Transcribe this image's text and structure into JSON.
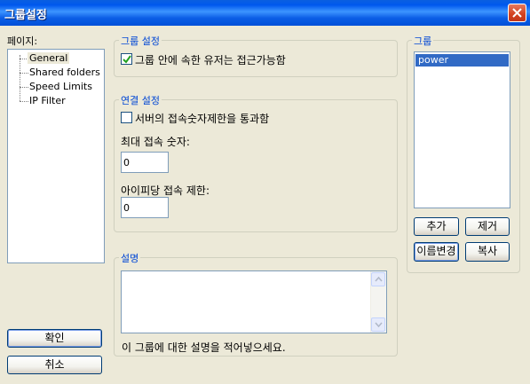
{
  "window": {
    "title": "그룹설정"
  },
  "pages": {
    "label": "페이지:",
    "items": [
      "General",
      "Shared folders",
      "Speed Limits",
      "IP Filter"
    ]
  },
  "group_settings": {
    "title": "그룹 설정",
    "access_checkbox_label": "그룹 안에 속한 유저는 접근가능함",
    "access_checked": true
  },
  "connection_settings": {
    "title": "연결 설정",
    "bypass_checkbox_label": "서버의 접속숫자제한을 통과함",
    "bypass_checked": false,
    "max_connections_label": "최대 접속 숫자:",
    "max_connections_value": "0",
    "per_ip_label": "아이피당 접속 제한:",
    "per_ip_value": "0"
  },
  "description": {
    "title": "설명",
    "hint": "이 그룹에 대한 설명을 적어넣으세요."
  },
  "groups": {
    "title": "그룹",
    "items": [
      "power"
    ],
    "selected": "power",
    "add_label": "추가",
    "remove_label": "제거",
    "rename_label": "이름변경",
    "copy_label": "복사"
  },
  "buttons": {
    "ok_label": "확인",
    "cancel_label": "취소"
  },
  "colors": {
    "accent": "#0046d5",
    "selection": "#316ac5",
    "titlebar": "#0058ee"
  }
}
